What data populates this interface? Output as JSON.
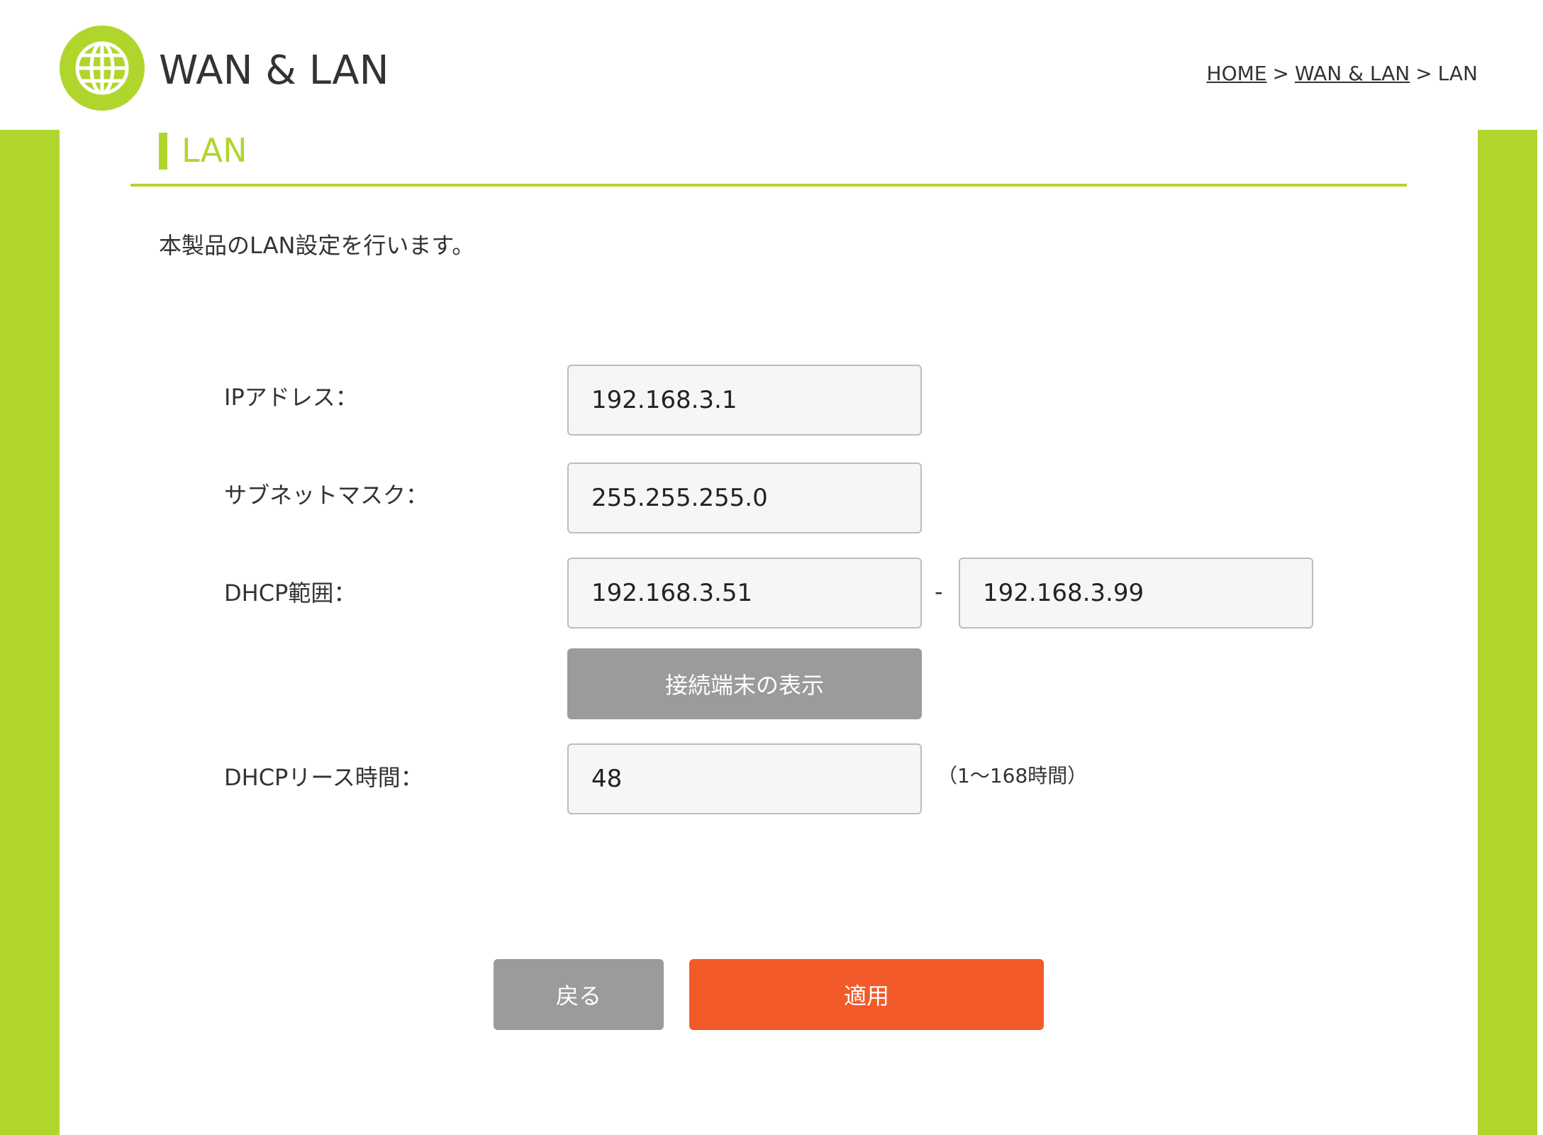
{
  "header": {
    "title": "WAN & LAN",
    "icon": "globe-icon"
  },
  "breadcrumb": {
    "home": "HOME",
    "separator": ">",
    "wan_lan": "WAN & LAN",
    "current": "LAN"
  },
  "section": {
    "title": "LAN",
    "description": "本製品のLAN設定を行います。"
  },
  "form": {
    "ip_address": {
      "label": "IPアドレス：",
      "value": "192.168.3.1"
    },
    "subnet_mask": {
      "label": "サブネットマスク：",
      "value": "255.255.255.0"
    },
    "dhcp_range": {
      "label": "DHCP範囲：",
      "start": "192.168.3.51",
      "separator": "-",
      "end": "192.168.3.99"
    },
    "show_devices_button": "接続端末の表示",
    "dhcp_lease": {
      "label": "DHCPリース時間：",
      "value": "48",
      "hint": "（1〜168時間）"
    }
  },
  "actions": {
    "back": "戻る",
    "apply": "適用"
  },
  "colors": {
    "accent": "#b0d62e",
    "apply": "#f25a2a",
    "secondary_button": "#9b9b9b",
    "input_background": "#f6f6f6"
  }
}
